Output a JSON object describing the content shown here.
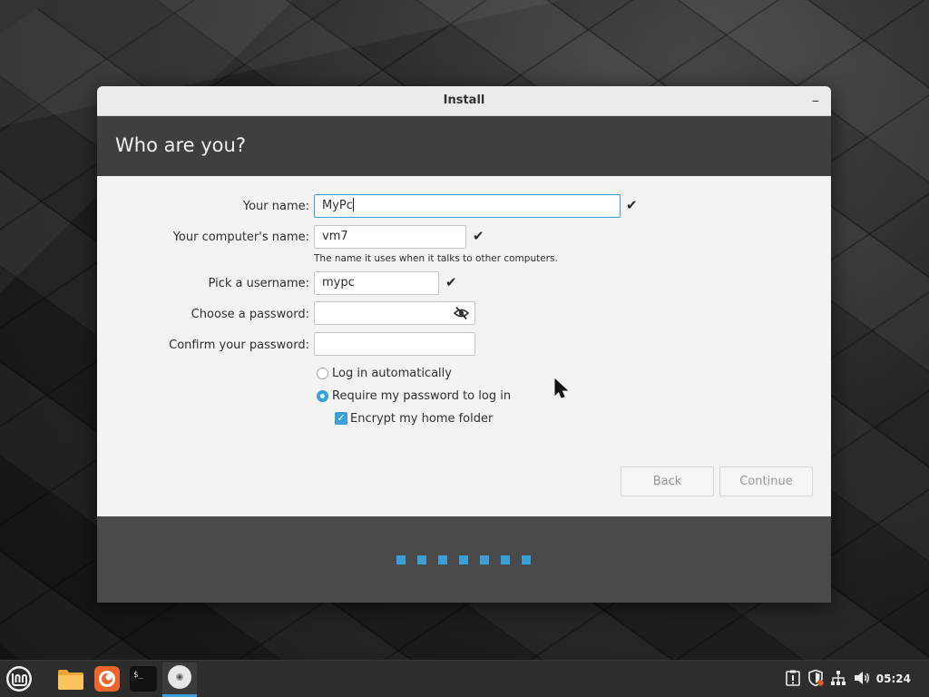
{
  "window": {
    "title": "Install",
    "minimize_label": "–",
    "heading": "Who are you?"
  },
  "form": {
    "your_name": {
      "label": "Your name:",
      "value": "MyPc"
    },
    "computer_name": {
      "label": "Your computer's name:",
      "value": "vm7",
      "hint": "The name it uses when it talks to other computers."
    },
    "username": {
      "label": "Pick a username:",
      "value": "mypc"
    },
    "password": {
      "label": "Choose a password:",
      "value": ""
    },
    "confirm_password": {
      "label": "Confirm your password:",
      "value": ""
    },
    "login_auto": {
      "label": "Log in automatically",
      "selected": false
    },
    "require_password": {
      "label": "Require my password to log in",
      "selected": true
    },
    "encrypt_home": {
      "label": "Encrypt my home folder",
      "checked": true
    }
  },
  "buttons": {
    "back": "Back",
    "continue": "Continue"
  },
  "progress": {
    "total_steps": 7
  },
  "taskbar": {
    "apps": [
      "menu-icon",
      "file-manager-icon",
      "firefox-icon",
      "terminal-icon",
      "install-disc-icon"
    ],
    "terminal_prompt": "$_",
    "clock": "05:24"
  },
  "colors": {
    "accent": "#3d9fd8",
    "header": "#3f3f3f",
    "footer": "#4a4a4a"
  }
}
